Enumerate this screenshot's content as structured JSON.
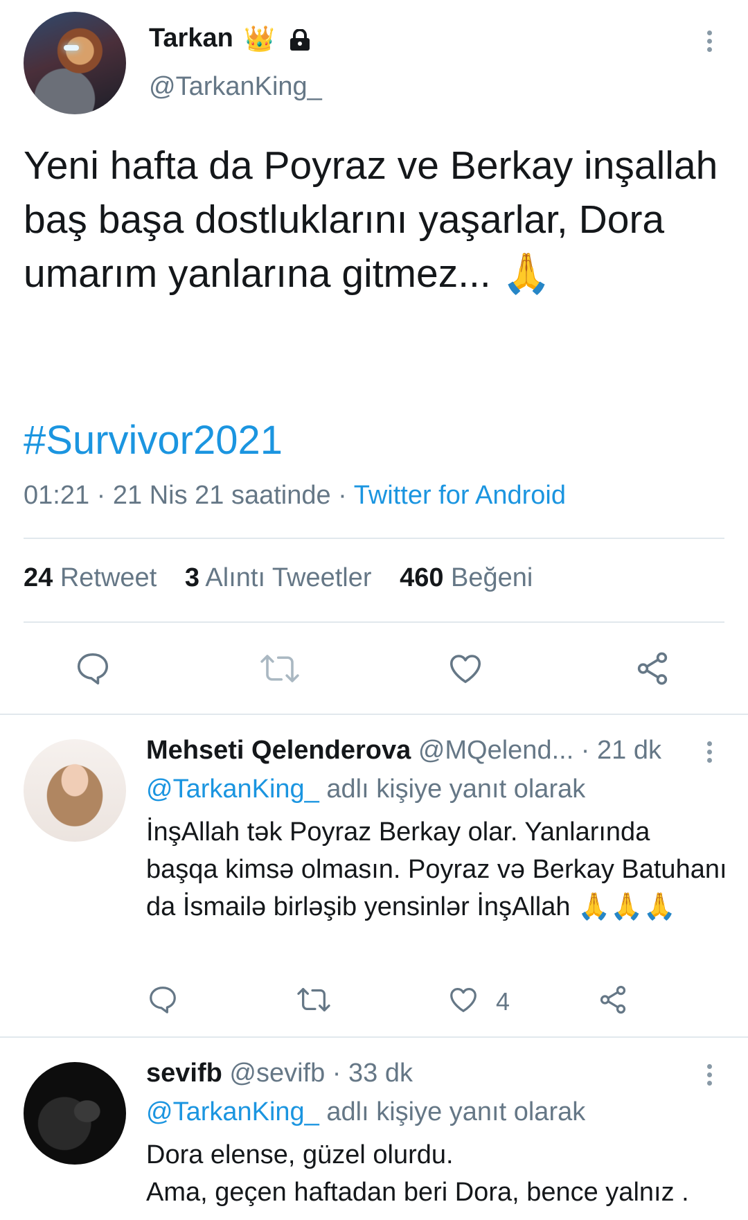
{
  "tweet": {
    "name": "Tarkan",
    "name_emoji": "👑",
    "handle": "@TarkanKing_",
    "text": "Yeni hafta da Poyraz ve Berkay inşallah baş başa dostluklarını yaşarlar, Dora umarım yanlarına gitmez... 🙏",
    "hashtag": "#Survivor2021",
    "time": "01:21 · 21 Nis 21 saatinde · ",
    "source": "Twitter for Android",
    "stats": {
      "retweets_count": "24",
      "retweets_label": "Retweet",
      "quotes_count": "3",
      "quotes_label": "Alıntı Tweetler",
      "likes_count": "460",
      "likes_label": "Beğeni"
    }
  },
  "replies": [
    {
      "name": "Mehseti Qelenderova",
      "handle": "@MQelend...",
      "time": " · 21 dk",
      "reply_to_mention": "@TarkanKing_",
      "reply_to_suffix": " adlı kişiye yanıt olarak",
      "text": "İnşAllah tək Poyraz Berkay olar. Yanlarında başqa kimsə olmasın. Poyraz və Berkay Batuhanı da İsmailə birləşib yensinlər İnşAllah 🙏🙏🙏",
      "like_count": "4"
    },
    {
      "name": "sevifb",
      "handle": "@sevifb",
      "time": " · 33 dk",
      "reply_to_mention": "@TarkanKing_",
      "reply_to_suffix": " adlı kişiye yanıt olarak",
      "text_line1": "Dora elense, güzel olurdu.",
      "text_line2": "Ama, geçen haftadan beri Dora, bence yalnız ."
    }
  ],
  "colors": {
    "link": "#1b95e0",
    "muted": "#657786",
    "text": "#14171a",
    "divider": "#e1e8ed"
  }
}
